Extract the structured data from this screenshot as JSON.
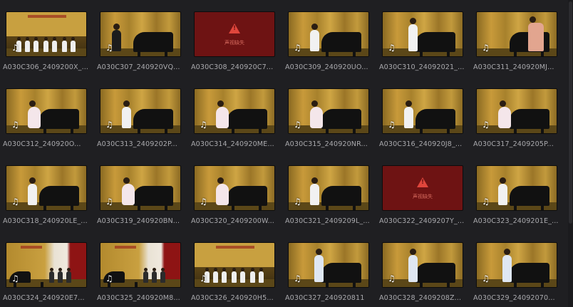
{
  "clips": [
    {
      "name": "A030C306_2409200X_...",
      "kind": "stage-group",
      "row": 0,
      "col": 0
    },
    {
      "name": "A030C307_240920VQ...",
      "kind": "piano-teacher",
      "row": 0,
      "col": 1
    },
    {
      "name": "A030C308_240920C7...",
      "kind": "offline",
      "row": 0,
      "col": 2,
      "warning": "声视缺失"
    },
    {
      "name": "A030C309_240920UO...",
      "kind": "piano",
      "row": 0,
      "col": 3
    },
    {
      "name": "A030C310_24092021_...",
      "kind": "piano-standing",
      "row": 0,
      "col": 4
    },
    {
      "name": "A030C311_240920MJ...",
      "kind": "piano-teacher2",
      "row": 0,
      "col": 5
    },
    {
      "name": "A030C312_240920O...",
      "kind": "piano-girl",
      "row": 1,
      "col": 0
    },
    {
      "name": "A030C313_2409202P...",
      "kind": "piano",
      "row": 1,
      "col": 1
    },
    {
      "name": "A030C314_240920ME...",
      "kind": "piano-girl",
      "row": 1,
      "col": 2
    },
    {
      "name": "A030C315_240920NR...",
      "kind": "piano-girl",
      "row": 1,
      "col": 3
    },
    {
      "name": "A030C316_240920J8_...",
      "kind": "piano",
      "row": 1,
      "col": 4
    },
    {
      "name": "A030C317_2409205P...",
      "kind": "piano-girl",
      "row": 1,
      "col": 5
    },
    {
      "name": "A030C318_240920LE_...",
      "kind": "piano",
      "row": 2,
      "col": 0
    },
    {
      "name": "A030C319_240920BN...",
      "kind": "piano-girl",
      "row": 2,
      "col": 1
    },
    {
      "name": "A030C320_2409200W...",
      "kind": "piano-girl",
      "row": 2,
      "col": 2
    },
    {
      "name": "A030C321_2409209L_...",
      "kind": "piano",
      "row": 2,
      "col": 3
    },
    {
      "name": "A030C322_2409207Y_...",
      "kind": "offline",
      "row": 2,
      "col": 4,
      "warning": "声视缺失"
    },
    {
      "name": "A030C323_2409201E_...",
      "kind": "piano",
      "row": 2,
      "col": 5
    },
    {
      "name": "A030C324_240920E7...",
      "kind": "stage-curtain",
      "row": 3,
      "col": 0
    },
    {
      "name": "A030C325_240920M8...",
      "kind": "stage-curtain2",
      "row": 3,
      "col": 1
    },
    {
      "name": "A030C326_240920H5...",
      "kind": "stage-group",
      "row": 3,
      "col": 2
    },
    {
      "name": "A030C327_240920811",
      "kind": "piano-standing-girl",
      "row": 3,
      "col": 3
    },
    {
      "name": "A030C328_2409208Z...",
      "kind": "piano-standing-girl",
      "row": 3,
      "col": 4
    },
    {
      "name": "A030C329_24092070...",
      "kind": "piano-standing-girl",
      "row": 3,
      "col": 5
    }
  ],
  "icons": {
    "audio": "♫",
    "audio_icon_name": "music-note-icon",
    "warning_icon_name": "warning-triangle-icon"
  }
}
